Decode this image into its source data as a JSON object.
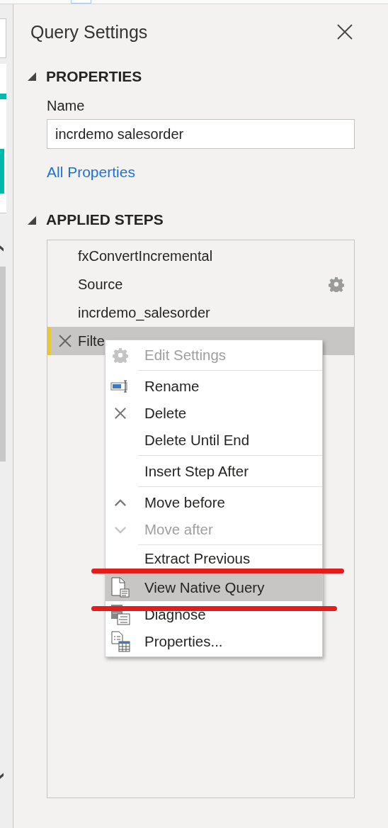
{
  "panel": {
    "title": "Query Settings"
  },
  "properties": {
    "heading": "PROPERTIES",
    "name_label": "Name",
    "name_value": "incrdemo salesorder",
    "link": "All Properties"
  },
  "applied_steps": {
    "heading": "APPLIED STEPS",
    "steps": [
      {
        "label": "fxConvertIncremental",
        "selected": false,
        "settings": false
      },
      {
        "label": "Source",
        "selected": false,
        "settings": true
      },
      {
        "label": "incrdemo_salesorder",
        "selected": false,
        "settings": false
      },
      {
        "label": "Filte",
        "selected": true,
        "settings": false
      }
    ]
  },
  "context_menu": {
    "groups": [
      [
        {
          "label": "Edit Settings",
          "disabled": true,
          "selected": false
        }
      ],
      [
        {
          "label": "Rename",
          "disabled": false,
          "selected": false
        },
        {
          "label": "Delete",
          "disabled": false,
          "selected": false
        },
        {
          "label": "Delete Until End",
          "disabled": false,
          "selected": false
        }
      ],
      [
        {
          "label": "Insert Step After",
          "disabled": false,
          "selected": false
        }
      ],
      [
        {
          "label": "Move before",
          "disabled": false,
          "selected": false
        },
        {
          "label": "Move after",
          "disabled": true,
          "selected": false
        }
      ],
      [
        {
          "label": "Extract Previous",
          "disabled": false,
          "selected": false
        },
        {
          "label": "View Native Query",
          "disabled": false,
          "selected": true
        },
        {
          "label": "Diagnose",
          "disabled": false,
          "selected": false
        },
        {
          "label": "Properties...",
          "disabled": false,
          "selected": false
        }
      ]
    ]
  }
}
